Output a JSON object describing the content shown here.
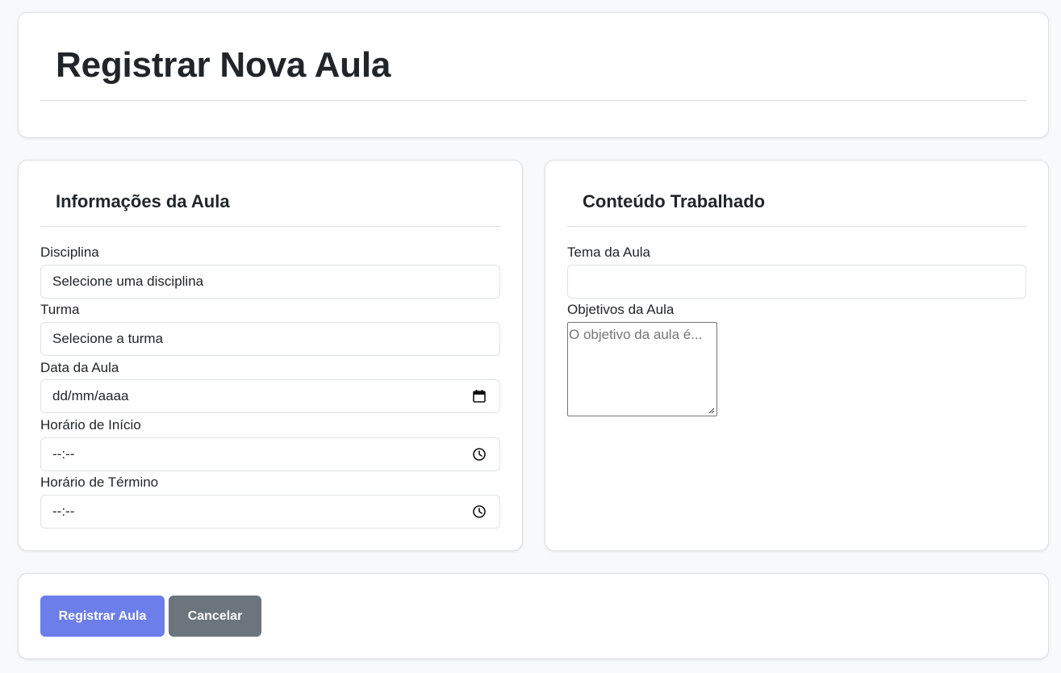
{
  "page": {
    "title": "Registrar Nova Aula"
  },
  "info_section": {
    "heading": "Informações da Aula",
    "fields": [
      {
        "label": "Disciplina",
        "value": "Selecione uma disciplina",
        "icon": ""
      },
      {
        "label": "Turma",
        "value": "Selecione a turma",
        "icon": ""
      },
      {
        "label": "Data da Aula",
        "value": "dd/mm/aaaa",
        "icon": "calendar-icon"
      },
      {
        "label": "Horário de Início",
        "value": "--:--",
        "icon": "clock-icon"
      },
      {
        "label": "Horário de Término",
        "value": "--:--",
        "icon": "clock-icon"
      }
    ]
  },
  "content_section": {
    "heading": "Conteúdo Trabalhado",
    "topic_label": "Tema da Aula",
    "topic_value": "",
    "objectives_label": "Objetivos da Aula",
    "objectives_placeholder": "O objetivo da aula é..."
  },
  "actions": {
    "submit_label": "Registrar Aula",
    "cancel_label": "Cancelar"
  },
  "colors": {
    "primary_button": "#6c7ee9",
    "secondary_button": "#6c757d",
    "background": "#f8f9fa"
  }
}
